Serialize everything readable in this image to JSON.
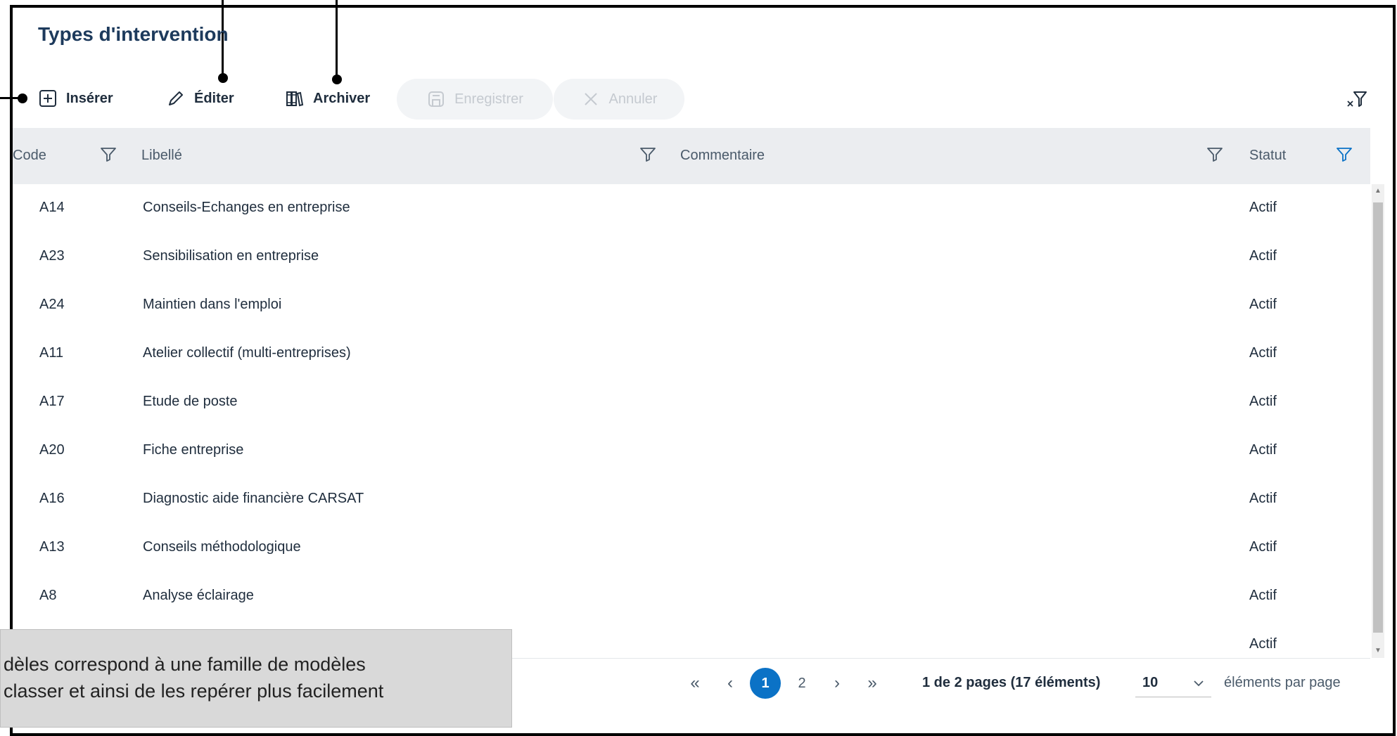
{
  "page": {
    "title": "Types d'intervention"
  },
  "toolbar": {
    "insert_label": "Insérer",
    "edit_label": "Éditer",
    "archive_label": "Archiver",
    "save_label": "Enregistrer",
    "cancel_label": "Annuler"
  },
  "table": {
    "columns": [
      "Code",
      "Libellé",
      "Commentaire",
      "Statut"
    ],
    "rows": [
      {
        "code": "A14",
        "libelle": "Conseils-Echanges en entreprise",
        "commentaire": "",
        "statut": "Actif"
      },
      {
        "code": "A23",
        "libelle": "Sensibilisation en entreprise",
        "commentaire": "",
        "statut": "Actif"
      },
      {
        "code": "A24",
        "libelle": "Maintien dans l'emploi",
        "commentaire": "",
        "statut": "Actif"
      },
      {
        "code": "A11",
        "libelle": "Atelier collectif (multi-entreprises)",
        "commentaire": "",
        "statut": "Actif"
      },
      {
        "code": "A17",
        "libelle": "Etude de poste",
        "commentaire": "",
        "statut": "Actif"
      },
      {
        "code": "A20",
        "libelle": "Fiche entreprise",
        "commentaire": "",
        "statut": "Actif"
      },
      {
        "code": "A16",
        "libelle": "Diagnostic aide financière CARSAT",
        "commentaire": "",
        "statut": "Actif"
      },
      {
        "code": "A13",
        "libelle": "Conseils méthodologique",
        "commentaire": "",
        "statut": "Actif"
      },
      {
        "code": "A8",
        "libelle": "Analyse éclairage",
        "commentaire": "",
        "statut": "Actif"
      },
      {
        "code": "",
        "libelle": "",
        "commentaire": "",
        "statut": "Actif"
      }
    ]
  },
  "pager": {
    "first": "«",
    "prev": "‹",
    "pages": [
      "1",
      "2"
    ],
    "current_page": "1",
    "next": "›",
    "last": "»",
    "info": "1 de 2 pages (17 éléments)",
    "page_size": "10",
    "per_page_label": "éléments par page"
  },
  "callout": {
    "line1": "dèles correspond à une famille de modèles",
    "line2": "classer et ainsi de les repérer plus facilement"
  },
  "colors": {
    "accent": "#0b72c6",
    "header_bg": "#ebedf0",
    "title": "#1d3a5c"
  }
}
